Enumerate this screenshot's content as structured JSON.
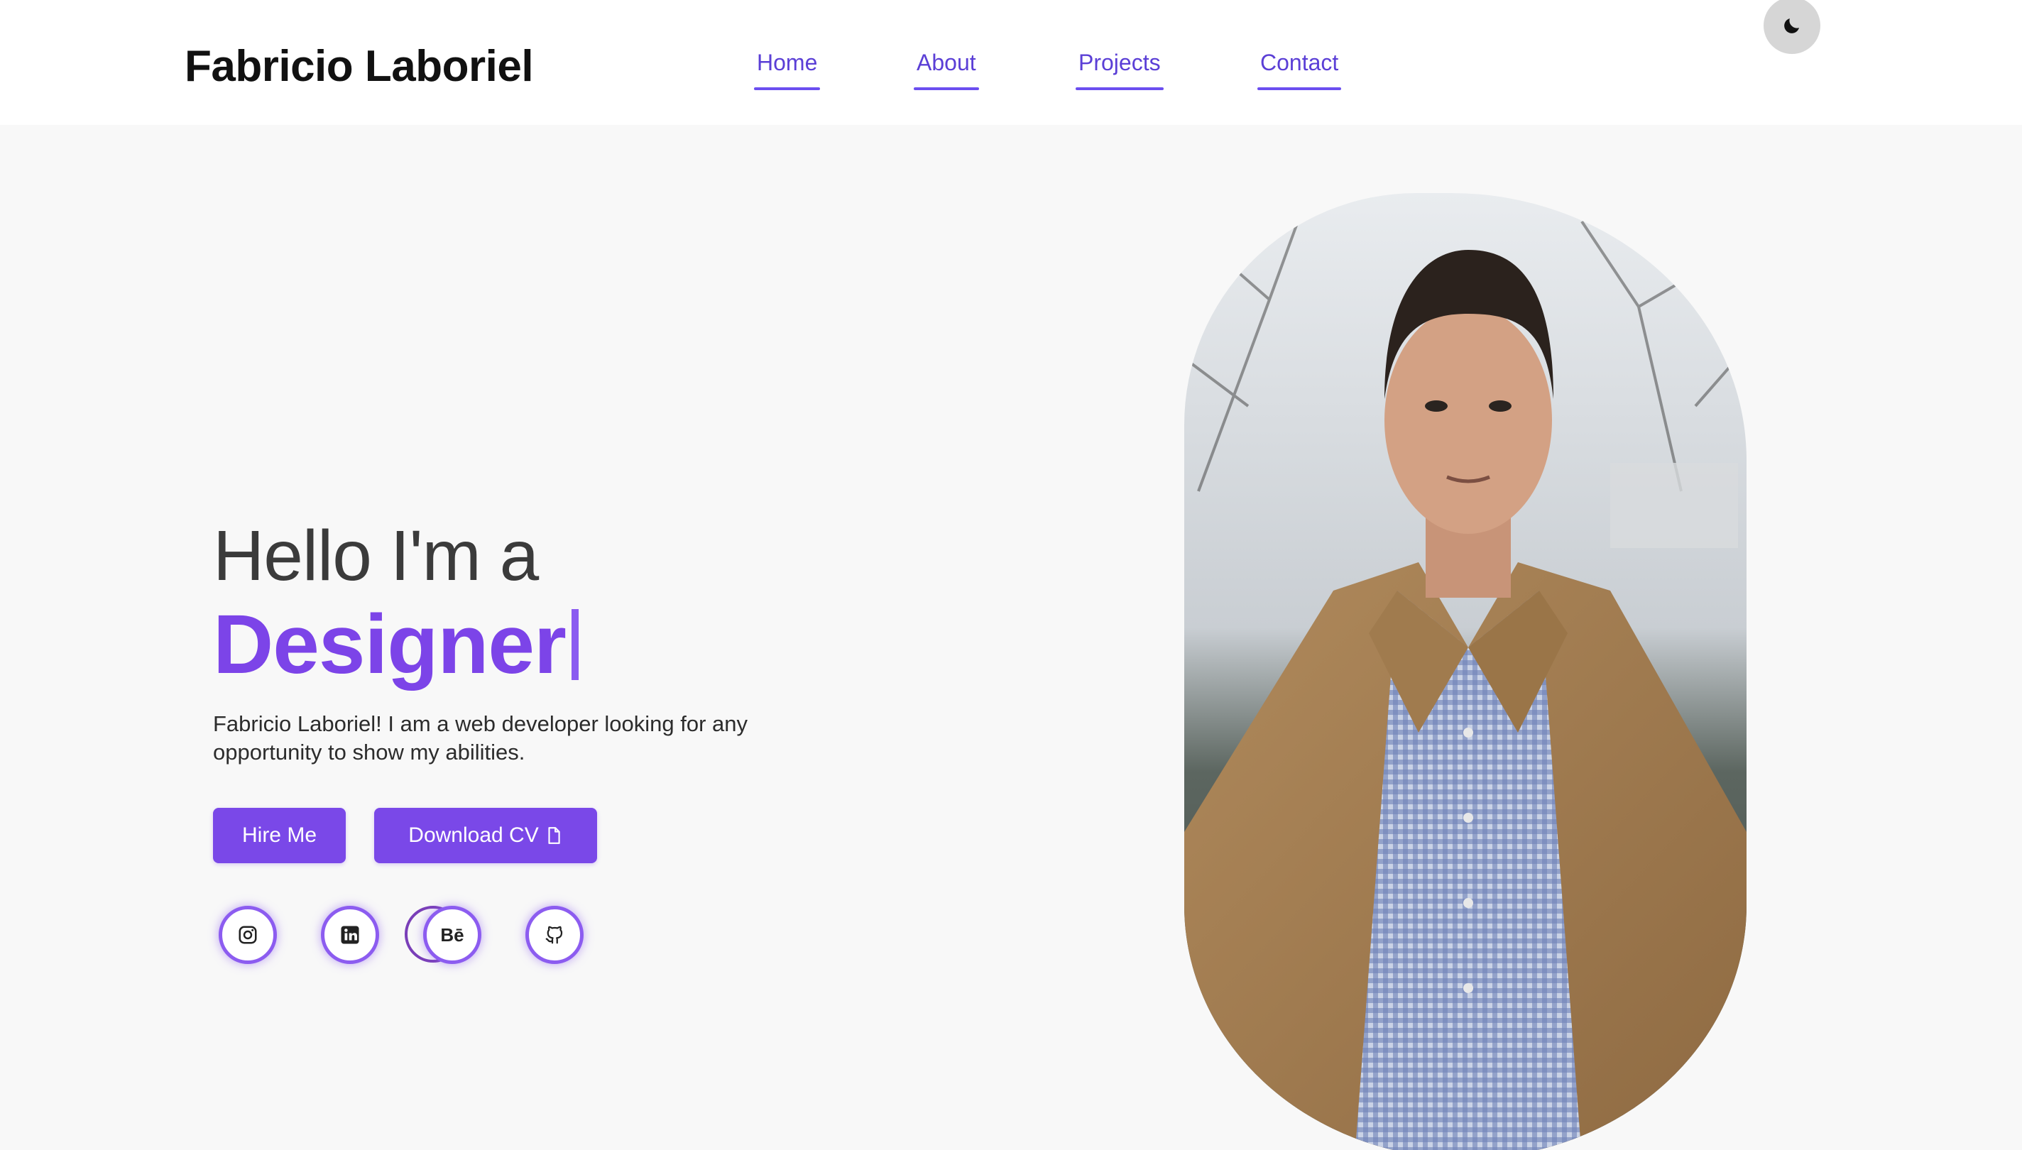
{
  "header": {
    "brand": "Fabricio Laboriel",
    "nav": [
      {
        "label": "Home"
      },
      {
        "label": "About"
      },
      {
        "label": "Projects"
      },
      {
        "label": "Contact"
      }
    ],
    "theme_toggle_icon": "moon-icon"
  },
  "hero": {
    "greeting": "Hello I'm a",
    "role": "Designer",
    "description": "Fabricio Laboriel! I am a web developer looking for any opportunity to show my abilities.",
    "hire_label": "Hire Me",
    "cv_label": "Download CV",
    "cv_icon": "file-icon"
  },
  "social": [
    {
      "icon": "instagram-icon"
    },
    {
      "icon": "linkedin-icon"
    },
    {
      "icon": "behance-icon",
      "text": "Bē"
    },
    {
      "icon": "github-icon"
    }
  ],
  "colors": {
    "accent": "#7a48e8",
    "nav_link": "#5b3fd6",
    "heading": "#3b3b3b",
    "background": "#f8f8f8"
  }
}
